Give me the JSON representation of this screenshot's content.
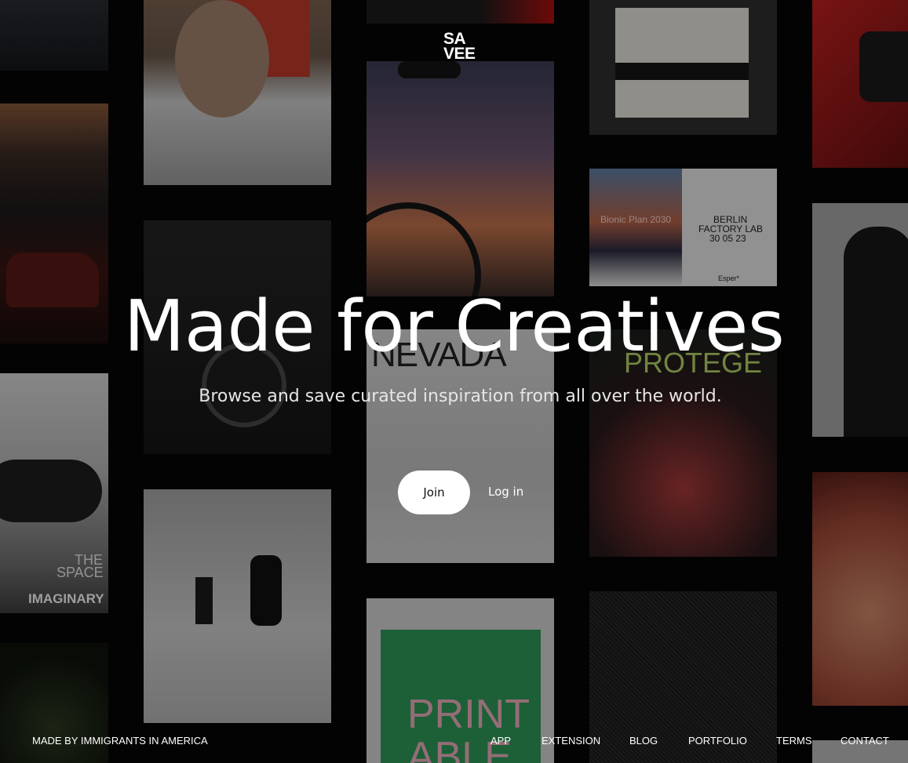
{
  "brand": {
    "logo_line1": "SA",
    "logo_line2": "VEE"
  },
  "hero": {
    "title": "Made for Creatives",
    "subtitle": "Browse and save curated inspiration from all over the world."
  },
  "actions": {
    "join_label": "Join",
    "login_label": "Log in"
  },
  "background_tiles": {
    "tile_texts": {
      "bionic": "Bionic Plan 2030",
      "berlin_line1": "BERLIN",
      "berlin_line2": "FACTORY LAB",
      "berlin_line3": "30 05 23",
      "esper": "Esper*",
      "nevada": "NEVADA",
      "protege": "PROTEGE",
      "the_space_1": "THE",
      "the_space_2": "SPACE",
      "imaginary": "IMAGINARY",
      "print_1": "PRINT",
      "print_2": "ABLE"
    }
  },
  "footer": {
    "tagline": "MADE BY IMMIGRANTS IN AMERICA",
    "nav": [
      "APP",
      "EXTENSION",
      "BLOG",
      "PORTFOLIO",
      "TERMS",
      "CONTACT"
    ]
  }
}
